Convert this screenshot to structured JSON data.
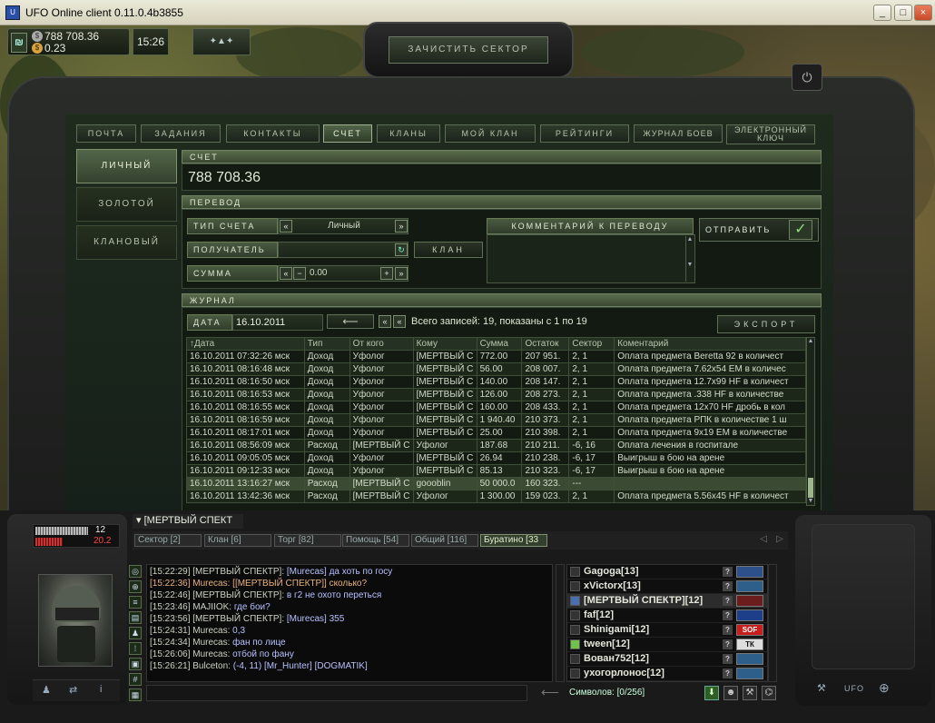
{
  "window": {
    "title": "UFO Online client 0.11.0.4b3855",
    "buttons": [
      "_",
      "□",
      "×"
    ]
  },
  "hud": {
    "money": "788 708.36",
    "gold": "0.23",
    "time": "15:26"
  },
  "clear_sector_label": "ЗАЧИСТИТЬ СЕКТОР",
  "tabs": [
    {
      "label": "ПОЧТА",
      "active": false
    },
    {
      "label": "ЗАДАНИЯ",
      "active": false
    },
    {
      "label": "КОНТАКТЫ",
      "active": false
    },
    {
      "label": "СЧЕТ",
      "active": true
    },
    {
      "label": "КЛАНЫ",
      "active": false
    },
    {
      "label": "МОЙ КЛАН",
      "active": false
    },
    {
      "label": "РЕЙТИНГИ",
      "active": false
    },
    {
      "label": "ЖУРНАЛ БОЕВ",
      "active": false
    },
    {
      "label": "ЭЛЕКТРОННЫЙ КЛЮЧ",
      "active": false
    }
  ],
  "side_menu": [
    {
      "label": "ЛИЧНЫЙ",
      "active": true
    },
    {
      "label": "ЗОЛОТОЙ",
      "active": false
    },
    {
      "label": "КЛАНОВЫЙ",
      "active": false
    }
  ],
  "account": {
    "header": "СЧЕТ",
    "balance": "788 708.36"
  },
  "transfer": {
    "header": "ПЕРЕВОД",
    "type_label": "ТИП СЧЕТА",
    "type_value": "Личный",
    "recipient_label": "ПОЛУЧАТЕЛЬ",
    "recipient_value": "",
    "clan_button": "КЛАН",
    "sum_label": "СУММА",
    "sum_value": "0.00",
    "comment_header": "КОММЕНТАРИЙ К ПЕРЕВОДУ",
    "send_button": "ОТПРАВИТЬ"
  },
  "journal": {
    "header": "ЖУРНАЛ",
    "date_label": "ДАТА",
    "date_value": "16.10.2011",
    "records_text": "Всего записей: 19, показаны с 1 по 19",
    "export_button": "ЭКСПОРТ",
    "columns": [
      "↑Дата",
      "Тип",
      "От кого",
      "Кому",
      "Сумма",
      "Остаток",
      "Сектор",
      "Коментарий"
    ],
    "rows": [
      [
        "16.10.2011 07:32:26 мск",
        "Доход",
        "Уфолог",
        "[МЕРТВЫЙ С",
        "772.00",
        "207 951.",
        "2, 1",
        "Оплата предмета Beretta 92 в количест"
      ],
      [
        "16.10.2011 08:16:48 мск",
        "Доход",
        "Уфолог",
        "[МЕРТВЫЙ С",
        "56.00",
        "208 007.",
        "2, 1",
        "Оплата предмета 7.62x54 EM в количес"
      ],
      [
        "16.10.2011 08:16:50 мск",
        "Доход",
        "Уфолог",
        "[МЕРТВЫЙ С",
        "140.00",
        "208 147.",
        "2, 1",
        "Оплата предмета 12.7x99 HF в количест"
      ],
      [
        "16.10.2011 08:16:53 мск",
        "Доход",
        "Уфолог",
        "[МЕРТВЫЙ С",
        "126.00",
        "208 273.",
        "2, 1",
        "Оплата предмета .338 HF в количестве"
      ],
      [
        "16.10.2011 08:16:55 мск",
        "Доход",
        "Уфолог",
        "[МЕРТВЫЙ С",
        "160.00",
        "208 433.",
        "2, 1",
        "Оплата предмета 12x70 HF дробь в кол"
      ],
      [
        "16.10.2011 08:16:59 мск",
        "Доход",
        "Уфолог",
        "[МЕРТВЫЙ С",
        "1 940.40",
        "210 373.",
        "2, 1",
        "Оплата предмета РПК в количестве 1 ш"
      ],
      [
        "16.10.2011 08:17:01 мск",
        "Доход",
        "Уфолог",
        "[МЕРТВЫЙ С",
        "25.00",
        "210 398.",
        "2, 1",
        "Оплата предмета 9x19 EM в количестве"
      ],
      [
        "16.10.2011 08:56:09 мск",
        "Расход",
        "[МЕРТВЫЙ С",
        "Уфолог",
        "187.68",
        "210 211.",
        "-6, 16",
        "Оплата лечения в госпитале"
      ],
      [
        "16.10.2011 09:05:05 мск",
        "Доход",
        "Уфолог",
        "[МЕРТВЫЙ С",
        "26.94",
        "210 238.",
        "-6, 17",
        "Выигрыш в бою на арене"
      ],
      [
        "16.10.2011 09:12:33 мск",
        "Доход",
        "Уфолог",
        "[МЕРТВЫЙ С",
        "85.13",
        "210 323.",
        "-6, 17",
        "Выигрыш в бою на арене"
      ],
      [
        "16.10.2011 13:16:27 мск",
        "Расход",
        "[МЕРТВЫЙ С",
        "goooblin",
        "50 000.0",
        "160 323.",
        "---",
        ""
      ],
      [
        "16.10.2011 13:42:36 мск",
        "Расход",
        "[МЕРТВЫЙ С",
        "Уфолог",
        "1 300.00",
        "159 023.",
        "2, 1",
        "Оплата предмета 5.56x45 HF в количест"
      ]
    ]
  },
  "player": {
    "bar1": "12",
    "bar2": "20.2",
    "name": "[МЕРТВЫЙ СПЕКТ"
  },
  "chat_tabs": [
    {
      "label": "Сектор [2]",
      "active": false
    },
    {
      "label": "Клан [6]",
      "active": false
    },
    {
      "label": "Торг [82]",
      "active": false
    },
    {
      "label": "Помощь [54]",
      "active": false
    },
    {
      "label": "Общий [116]",
      "active": false
    },
    {
      "label": "Буратино [33",
      "active": true
    }
  ],
  "chat": [
    {
      "time": "[15:22:29]",
      "who": "[МЕРТВЫЙ СПЕКТР]:",
      "text": "[Murecas] да хоть по госу",
      "hl": false
    },
    {
      "time": "[15:22:36]",
      "who": "Murecas:",
      "text": "[[МЕРТВЫЙ СПЕКТР]] сколько?",
      "hl": true
    },
    {
      "time": "[15:22:46]",
      "who": "[МЕРТВЫЙ СПЕКТР]:",
      "text": "в г2 не охото переться",
      "hl": false
    },
    {
      "time": "[15:23:46]",
      "who": "MAJIIOK:",
      "text": "где бои?",
      "hl": false
    },
    {
      "time": "[15:23:56]",
      "who": "[МЕРТВЫЙ СПЕКТР]:",
      "text": "[Murecas] 355",
      "hl": false
    },
    {
      "time": "[15:24:31]",
      "who": "Murecas:",
      "text": "0,3",
      "hl": false
    },
    {
      "time": "[15:24:34]",
      "who": "Murecas:",
      "text": "фан по лице",
      "hl": false
    },
    {
      "time": "[15:26:06]",
      "who": "Murecas:",
      "text": "отбой по фану",
      "hl": false
    },
    {
      "time": "[15:26:21]",
      "who": "Bulceton:",
      "text": "(-4, 11) [Mr_Hunter] [DOGMATIK]",
      "hl": false
    }
  ],
  "users": [
    {
      "name": "Gagoga[13]",
      "badge": "",
      "badge_color": "#2d4f8a"
    },
    {
      "name": "xVictorx[13]",
      "badge": "",
      "badge_color": "#2d5f8a"
    },
    {
      "name": "[МЕРТВЫЙ СПЕКТР][12]",
      "badge": "",
      "badge_color": "#6b1d1d"
    },
    {
      "name": "faf[12]",
      "badge": "",
      "badge_color": "#1d3f8a"
    },
    {
      "name": "Shinigami[12]",
      "badge": "SOF",
      "badge_color": "#c81e1e"
    },
    {
      "name": "tween[12]",
      "badge": "ТК",
      "badge_color": "#dddddd"
    },
    {
      "name": "Вован752[12]",
      "badge": "",
      "badge_color": "#2d5f8a"
    },
    {
      "name": "ухогорлонос[12]",
      "badge": "",
      "badge_color": "#2d5f8a"
    }
  ],
  "chat_symbols": "Символов: [0/256]",
  "ufo_label": "UFO"
}
